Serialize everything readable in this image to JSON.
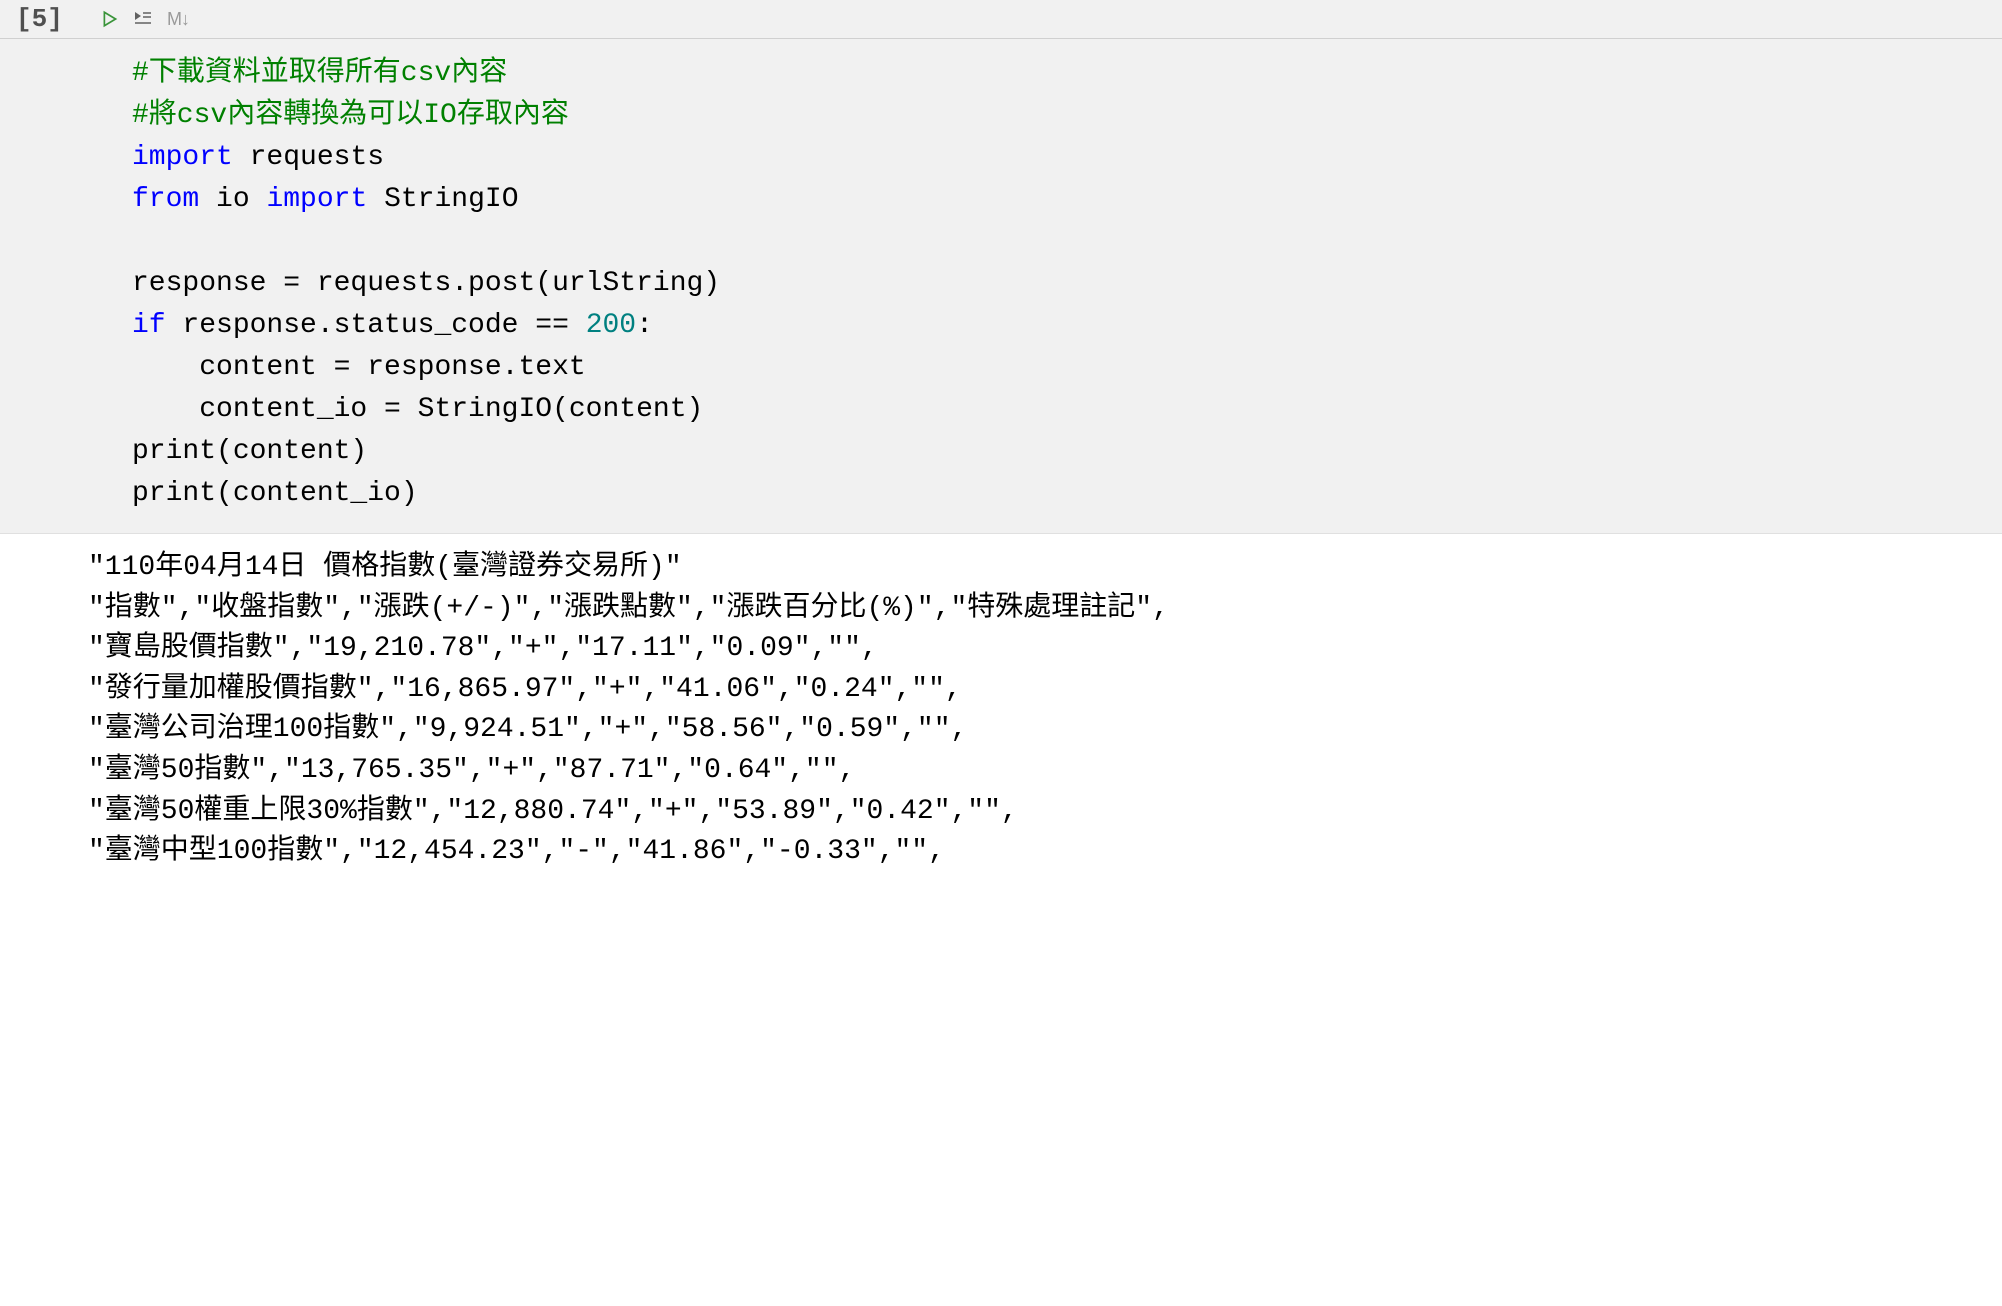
{
  "cell": {
    "prompt": "[5]",
    "toolbar": {
      "run_title": "Run Cell",
      "run_by_line_title": "Run by Line",
      "markdown_label": "M↓"
    },
    "code_lines": [
      [
        {
          "cls": "tok-comment",
          "text": "#下載資料並取得所有csv內容"
        }
      ],
      [
        {
          "cls": "tok-comment",
          "text": "#將csv內容轉換為可以IO存取內容"
        }
      ],
      [
        {
          "cls": "tok-keyword",
          "text": "import"
        },
        {
          "cls": "tok-default",
          "text": " requests"
        }
      ],
      [
        {
          "cls": "tok-keyword",
          "text": "from"
        },
        {
          "cls": "tok-default",
          "text": " io "
        },
        {
          "cls": "tok-keyword",
          "text": "import"
        },
        {
          "cls": "tok-default",
          "text": " StringIO"
        }
      ],
      [
        {
          "cls": "tok-default",
          "text": ""
        }
      ],
      [
        {
          "cls": "tok-default",
          "text": "response = requests.post(urlString)"
        }
      ],
      [
        {
          "cls": "tok-keyword",
          "text": "if"
        },
        {
          "cls": "tok-default",
          "text": " response.status_code == "
        },
        {
          "cls": "tok-number",
          "text": "200"
        },
        {
          "cls": "tok-default",
          "text": ":"
        }
      ],
      [
        {
          "cls": "tok-default",
          "text": "    content = response.text"
        }
      ],
      [
        {
          "cls": "tok-default",
          "text": "    content_io = StringIO(content)"
        }
      ],
      [
        {
          "cls": "tok-default",
          "text": "print(content)"
        }
      ],
      [
        {
          "cls": "tok-default",
          "text": "print(content_io)"
        }
      ]
    ],
    "output_lines": [
      "\"110年04月14日 價格指數(臺灣證券交易所)\"",
      "\"指數\",\"收盤指數\",\"漲跌(+/-)\",\"漲跌點數\",\"漲跌百分比(%)\",\"特殊處理註記\",",
      "\"寶島股價指數\",\"19,210.78\",\"+\",\"17.11\",\"0.09\",\"\",",
      "\"發行量加權股價指數\",\"16,865.97\",\"+\",\"41.06\",\"0.24\",\"\",",
      "\"臺灣公司治理100指數\",\"9,924.51\",\"+\",\"58.56\",\"0.59\",\"\",",
      "\"臺灣50指數\",\"13,765.35\",\"+\",\"87.71\",\"0.64\",\"\",",
      "\"臺灣50權重上限30%指數\",\"12,880.74\",\"+\",\"53.89\",\"0.42\",\"\",",
      "\"臺灣中型100指數\",\"12,454.23\",\"-\",\"41.86\",\"-0.33\",\"\","
    ]
  }
}
